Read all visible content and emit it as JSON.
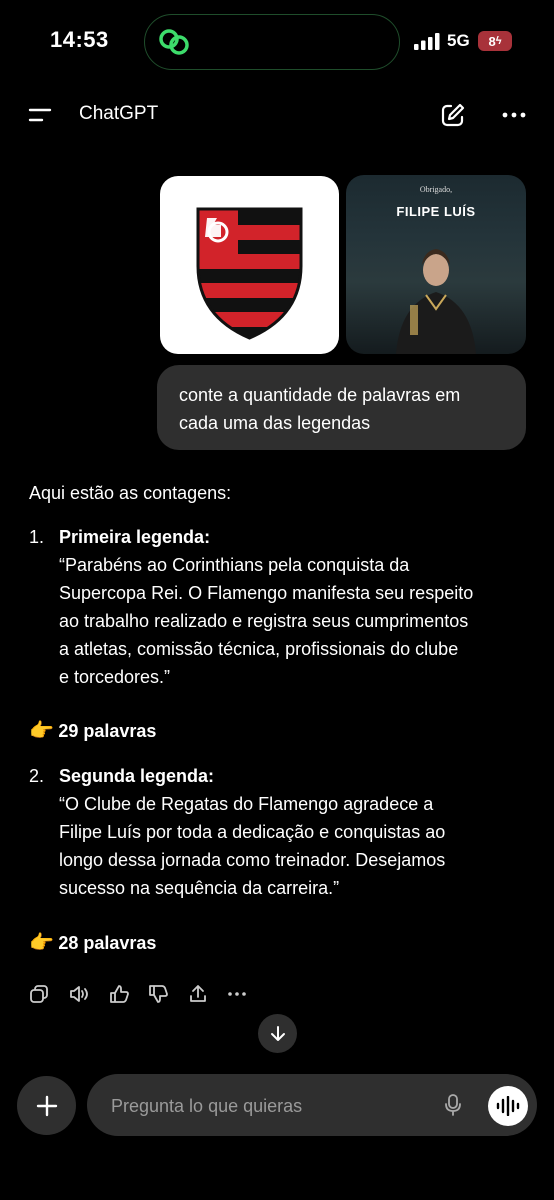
{
  "status_bar": {
    "time": "14:53",
    "network": "5G",
    "battery": "8"
  },
  "header": {
    "title": "ChatGPT"
  },
  "attachments": {
    "image2_subtitle": "Obrigado,",
    "image2_title": "FILIPE LUÍS"
  },
  "user_message": "conte a quantidade de palavras em cada uma das legendas",
  "assistant": {
    "intro": "Aqui estão as contagens:",
    "items": [
      {
        "number": "1.",
        "heading": "Primeira legenda:",
        "lines": [
          "“Parabéns ao Corinthians pela conquista da",
          "Supercopa Rei. O Flamengo manifesta seu respeito",
          "ao trabalho realizado e registra seus cumprimentos",
          "a atletas, comissão técnica, profissionais do clube",
          "e torcedores.”"
        ],
        "emoji": "👉",
        "count": "29 palavras"
      },
      {
        "number": "2.",
        "heading": "Segunda legenda:",
        "lines": [
          "“O Clube de Regatas do Flamengo agradece a",
          "Filipe Luís por toda a dedicação e conquistas ao",
          "longo dessa jornada como treinador. Desejamos",
          "sucesso na sequência da carreira.”"
        ],
        "emoji": "👉",
        "count": "28 palavras"
      }
    ]
  },
  "composer": {
    "placeholder": "Pregunta lo que quieras"
  },
  "colors": {
    "bubble": "#2f2f2f",
    "background": "#000000",
    "battery": "#a8323a",
    "island_accent": "#3ddc6b"
  }
}
